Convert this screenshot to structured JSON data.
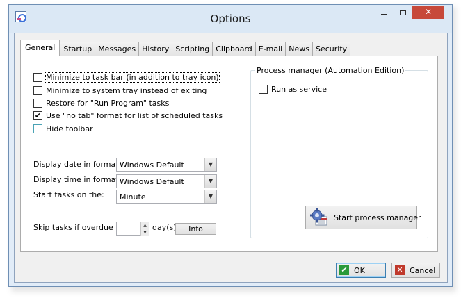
{
  "window": {
    "title": "Options",
    "controls": {
      "minimize": "",
      "maximize": "",
      "close": "✕"
    }
  },
  "tabs": [
    {
      "label": "General",
      "active": true
    },
    {
      "label": "Startup"
    },
    {
      "label": "Messages"
    },
    {
      "label": "History"
    },
    {
      "label": "Scripting"
    },
    {
      "label": "Clipboard"
    },
    {
      "label": "E-mail"
    },
    {
      "label": "News"
    },
    {
      "label": "Security"
    }
  ],
  "general": {
    "checkboxes": [
      {
        "label": "Minimize to task bar (in addition to tray icon)",
        "checked": false
      },
      {
        "label": "Minimize to system tray instead of exiting",
        "checked": false
      },
      {
        "label": "Restore for \"Run Program\" tasks",
        "checked": false
      },
      {
        "label": "Use \"no tab\" format for list of scheduled tasks",
        "checked": true
      },
      {
        "label": "Hide toolbar",
        "checked": false
      }
    ],
    "date_format": {
      "label": "Display date in format:",
      "value": "Windows Default"
    },
    "time_format": {
      "label": "Display time in format:",
      "value": "Windows Default"
    },
    "start_tasks": {
      "label": "Start tasks on the:",
      "value": "Minute"
    },
    "skip_overdue": {
      "label": "Skip tasks if overdue by",
      "value": "",
      "unit": "day(s)",
      "info_button": "Info"
    },
    "process_manager": {
      "group_title": "Process manager (Automation Edition)",
      "run_as_service": {
        "label": "Run as service",
        "checked": false
      },
      "start_button": "Start process manager"
    }
  },
  "dialog": {
    "ok_label": "OK",
    "cancel_label": "Cancel"
  }
}
